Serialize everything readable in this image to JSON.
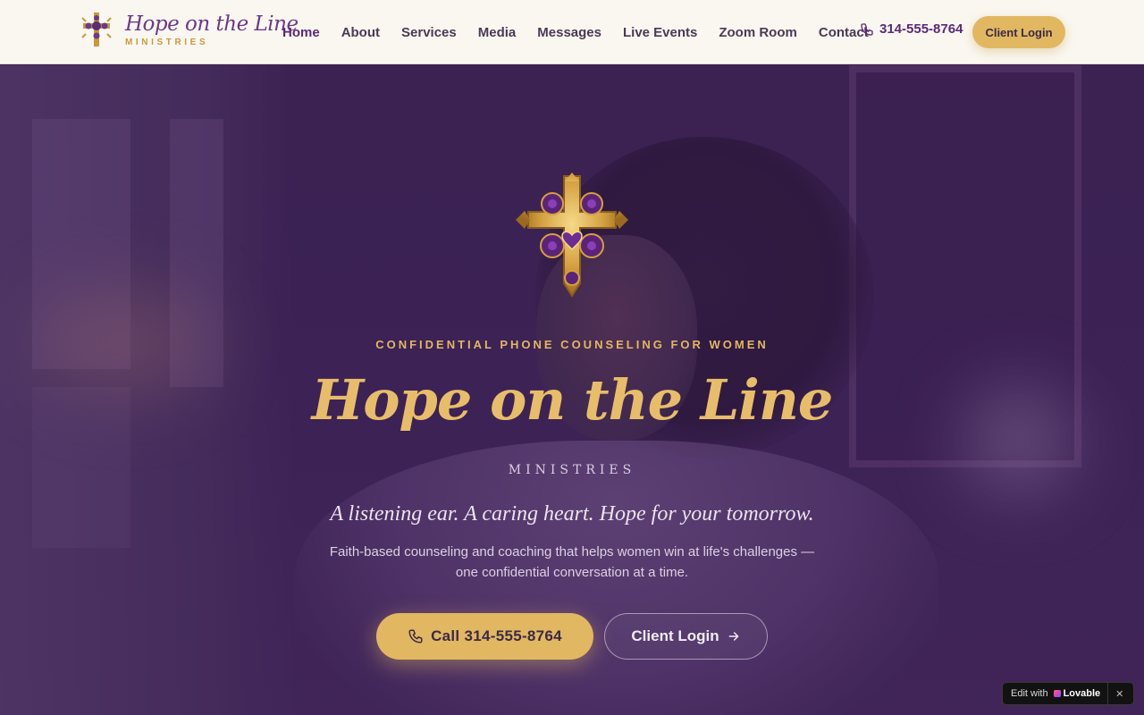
{
  "nav": {
    "brand_script": "Hope on the Line",
    "brand_sub": "MINISTRIES",
    "links": [
      {
        "label": "Home",
        "active": true
      },
      {
        "label": "About"
      },
      {
        "label": "Services"
      },
      {
        "label": "Media"
      },
      {
        "label": "Messages"
      },
      {
        "label": "Live Events"
      },
      {
        "label": "Zoom Room"
      },
      {
        "label": "Contact"
      }
    ],
    "phone": "314-555-8764",
    "login_label": "Client Login"
  },
  "hero": {
    "eyebrow": "CONFIDENTIAL PHONE COUNSELING FOR WOMEN",
    "title": "Hope on the Line",
    "subtitle": "MINISTRIES",
    "tagline": "A listening ear. A caring heart. Hope for your tomorrow.",
    "description": "Faith-based counseling and coaching that helps women win at life's challenges — one confidential conversation at a time.",
    "call_label": "Call 314-555-8764",
    "login_label": "Client Login"
  },
  "badge": {
    "edit_label": "Edit with",
    "brand": "Lovable",
    "close": "✕"
  },
  "colors": {
    "accent_gold": "#e2b762",
    "brand_purple": "#5b2a78",
    "hero_bg": "#3e2556"
  },
  "icons": [
    "brand-cross-icon",
    "phone-icon",
    "cross-crest-icon",
    "arrow-right-icon",
    "close-icon"
  ]
}
